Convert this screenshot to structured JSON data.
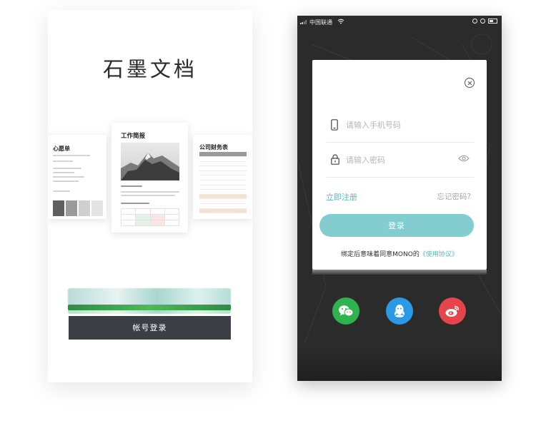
{
  "left_phone": {
    "brand_title": "石墨文档",
    "cards": {
      "left_title": "心愿单",
      "mid_title": "工作简报",
      "right_title": "公司财务表"
    },
    "account_login_label": "帐号登录"
  },
  "right_phone": {
    "status": {
      "carrier": "中国联通"
    },
    "login_modal": {
      "phone_placeholder": "请输入手机号码",
      "password_placeholder": "请输入密码",
      "register_label": "立即注册",
      "forgot_label": "忘记密码?",
      "login_label": "登录",
      "agreement_text": "绑定后意味着同意MONO的",
      "agreement_link": "《使用协议》"
    },
    "social": [
      "wechat-icon",
      "qq-icon",
      "weibo-icon"
    ]
  },
  "colors": {
    "accent": "#83cdd1",
    "link": "#5bb8bd",
    "dark_button": "#3b3e44",
    "wechat": "#2fb34f",
    "qq": "#2a9ae4",
    "weibo": "#e6444c"
  }
}
